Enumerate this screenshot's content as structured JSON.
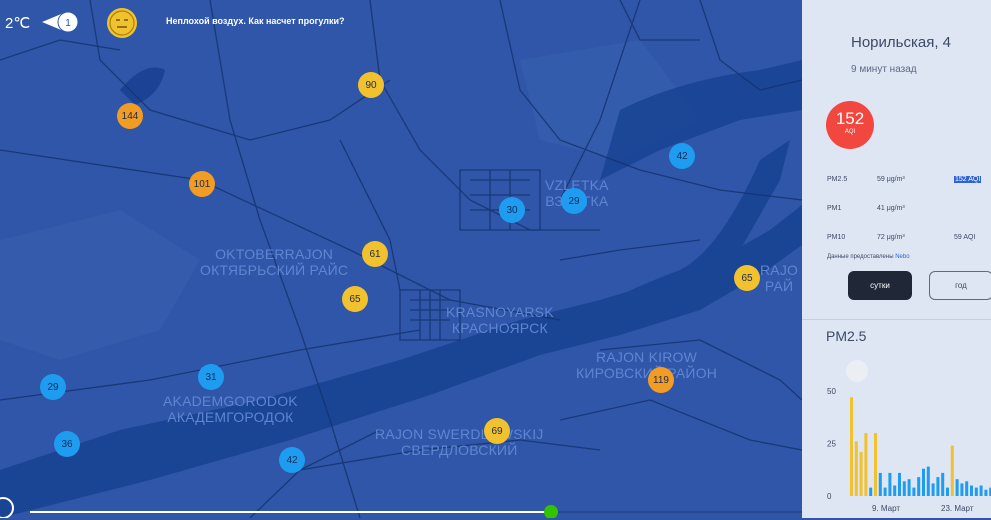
{
  "header": {
    "temperature": "2℃",
    "nav_count": "1",
    "message": "Неплохой воздух. Как насчет прогулки?"
  },
  "map": {
    "districts": [
      {
        "id": "okt",
        "lines": [
          "OKTOBERRAJON",
          "ОКТЯБРЬСКИЙ РАЙС"
        ]
      },
      {
        "id": "vzl",
        "lines": [
          "VZLETKA",
          "ВЗЛЕТКА"
        ]
      },
      {
        "id": "kras",
        "lines": [
          "KRASNOYARSK",
          "КРАСНОЯРСК"
        ]
      },
      {
        "id": "kir",
        "lines": [
          "RAJON KIROW",
          "КИРОВСКИЙ РАЙОН"
        ]
      },
      {
        "id": "akd",
        "lines": [
          "AKADEMGORODOK",
          "АКАДЕМГОРОДОК"
        ]
      },
      {
        "id": "swe",
        "lines": [
          "RAJON SWERDLOWSKIJ",
          "СВЕРДЛОВСКИЙ"
        ]
      },
      {
        "id": "rajo",
        "lines": [
          "RAJO",
          "РАЙ"
        ]
      }
    ],
    "markers": [
      {
        "value": "90",
        "level": "y"
      },
      {
        "value": "144",
        "level": "o"
      },
      {
        "value": "101",
        "level": "o"
      },
      {
        "value": "42",
        "level": "b"
      },
      {
        "value": "30",
        "level": "b"
      },
      {
        "value": "29",
        "level": "b"
      },
      {
        "value": "61",
        "level": "y"
      },
      {
        "value": "65",
        "level": "y"
      },
      {
        "value": "65",
        "level": "y"
      },
      {
        "value": "29",
        "level": "b"
      },
      {
        "value": "31",
        "level": "b"
      },
      {
        "value": "119",
        "level": "o"
      },
      {
        "value": "36",
        "level": "b"
      },
      {
        "value": "69",
        "level": "y"
      },
      {
        "value": "42",
        "level": "b"
      }
    ],
    "timeline_progress": 0.68
  },
  "panel": {
    "station": "Норильская, 4",
    "updated": "9 минут назад",
    "aqi": {
      "value": "152",
      "unit": "AQI",
      "color": "#f2473f"
    },
    "pollutants": [
      {
        "name": "PM2.5",
        "value": "59 μg/m³",
        "aqi": "152 AQI"
      },
      {
        "name": "PM1",
        "value": "41 μg/m³",
        "aqi": ""
      },
      {
        "name": "PM10",
        "value": "72 μg/m³",
        "aqi": "59 AQI"
      }
    ],
    "source_prefix": "Данные предоставлены",
    "source_name": "Nebo",
    "tabs": {
      "day": "сутки",
      "year": "год"
    }
  },
  "chart_data": {
    "type": "bar",
    "title": "PM2.5",
    "ylim": [
      0,
      60
    ],
    "yticks": [
      "0",
      "25",
      "50"
    ],
    "xticks": [
      "9. Март",
      "23. Март"
    ],
    "colors": {
      "high": "#f2c12e",
      "low": "#1e9cf0"
    },
    "values": [
      47,
      26,
      21,
      30,
      4,
      30,
      11,
      4,
      11,
      5,
      11,
      7,
      8,
      4,
      9,
      13,
      14,
      6,
      9,
      11,
      4,
      24,
      8,
      6,
      7,
      5,
      4,
      5,
      3,
      4,
      3,
      4,
      5
    ]
  }
}
